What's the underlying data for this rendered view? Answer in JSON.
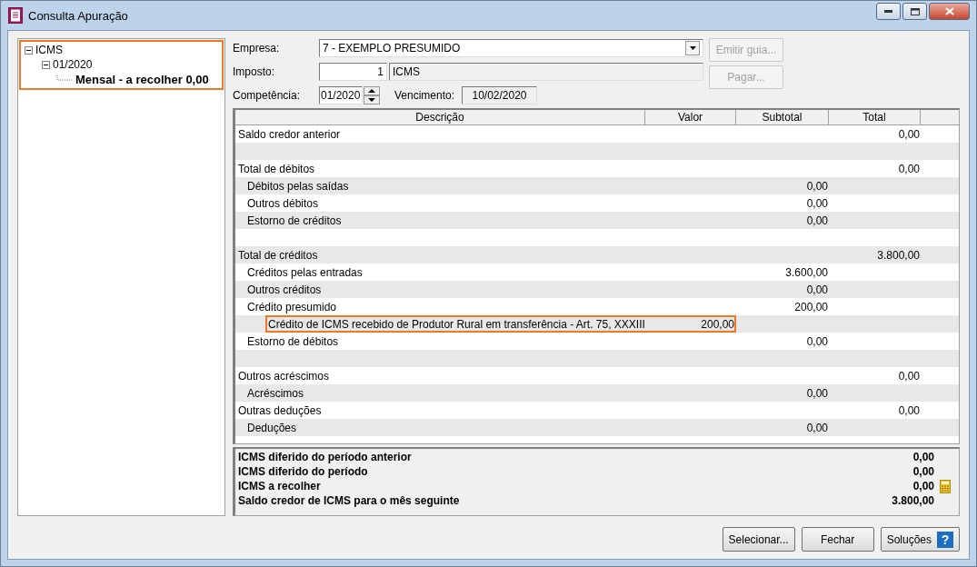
{
  "window": {
    "title": "Consulta Apuração"
  },
  "tree": {
    "highlighted": true,
    "items": [
      {
        "label": "ICMS",
        "expanded": true,
        "children": [
          {
            "label": "01/2020",
            "expanded": true,
            "children": [
              {
                "label": "Mensal - a recolher 0,00",
                "selected": true
              }
            ]
          }
        ]
      }
    ]
  },
  "form": {
    "empresa_label": "Empresa:",
    "empresa_value": "7 - EXEMPLO PRESUMIDO",
    "imposto_label": "Imposto:",
    "imposto_code": "1",
    "imposto_name": "ICMS",
    "competencia_label": "Competência:",
    "competencia_value": "01/2020",
    "vencimento_label": "Vencimento:",
    "vencimento_value": "10/02/2020"
  },
  "side_buttons": [
    {
      "label": "Emitir guia...",
      "disabled": true
    },
    {
      "label": "Pagar...",
      "disabled": true
    }
  ],
  "table": {
    "columns": [
      "Descrição",
      "Valor",
      "Subtotal",
      "Total"
    ],
    "rows": [
      {
        "kind": "item",
        "label": "Saldo credor anterior",
        "total": "0,00"
      },
      {
        "kind": "spacer"
      },
      {
        "kind": "item",
        "label": "Total de débitos",
        "total": "0,00",
        "children": [
          {
            "kind": "item",
            "label": "Débitos pelas saídas",
            "subtotal": "0,00"
          },
          {
            "kind": "item",
            "label": "Outros débitos",
            "subtotal": "0,00"
          },
          {
            "kind": "item",
            "label": "Estorno de créditos",
            "subtotal": "0,00"
          }
        ]
      },
      {
        "kind": "spacer"
      },
      {
        "kind": "item",
        "label": "Total de créditos",
        "total": "3.800,00",
        "children": [
          {
            "kind": "item",
            "label": "Créditos pelas entradas",
            "subtotal": "3.600,00"
          },
          {
            "kind": "item",
            "label": "Outros créditos",
            "subtotal": "0,00"
          },
          {
            "kind": "item",
            "label": "Crédito presumido",
            "subtotal": "200,00",
            "children": [
              {
                "kind": "item",
                "label": "Crédito de ICMS recebido de Produtor Rural em transferência - Art. 75, XXXIII",
                "valor": "200,00",
                "highlighted": true
              }
            ]
          },
          {
            "kind": "item",
            "label": "Estorno de débitos",
            "subtotal": "0,00"
          }
        ]
      },
      {
        "kind": "spacer"
      },
      {
        "kind": "item",
        "label": "Outros acréscimos",
        "total": "0,00",
        "children": [
          {
            "kind": "item",
            "label": "Acréscimos",
            "subtotal": "0,00"
          }
        ]
      },
      {
        "kind": "item",
        "label": "Outras deduções",
        "total": "0,00",
        "children": [
          {
            "kind": "item",
            "label": "Deduções",
            "subtotal": "0,00"
          }
        ]
      }
    ]
  },
  "summary": [
    {
      "label": "ICMS diferido do período anterior",
      "value": "0,00"
    },
    {
      "label": "ICMS diferido do período",
      "value": "0,00"
    },
    {
      "label": "ICMS a recolher",
      "value": "0,00",
      "calculator": true
    },
    {
      "label": "Saldo credor de ICMS para o mês seguinte",
      "value": "3.800,00"
    }
  ],
  "buttons": [
    {
      "label": "Selecionar...",
      "help": false
    },
    {
      "label": "Fechar",
      "help": false
    },
    {
      "label": "Soluções",
      "help": true,
      "help_glyph": "?"
    }
  ]
}
